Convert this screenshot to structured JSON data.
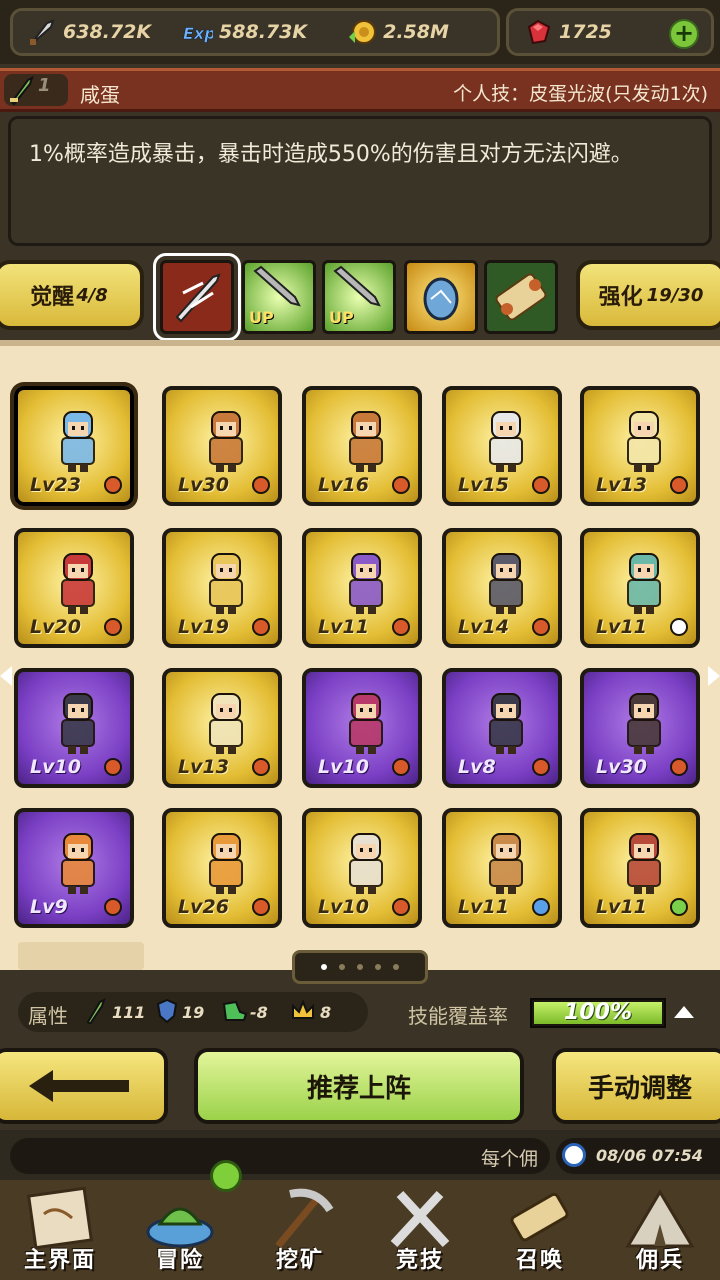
{
  "resources": {
    "attack": "638.72K",
    "exp": "588.73K",
    "gold": "2.58M",
    "gems": "1725"
  },
  "skill": {
    "level": "1",
    "name": "咸蛋",
    "personal": "个人技：皮蛋光波(只发动1次)",
    "description": "1%概率造成暴击，暴击时造成550%的伤害且对方无法闪避。"
  },
  "tabs": {
    "awaken_label": "觉醒",
    "awaken_count": "4/8",
    "enhance_label": "强化",
    "enhance_count": "19/30",
    "up1": "UP",
    "up2": "UP"
  },
  "heroes": [
    {
      "lv": "Lv23",
      "color": "gold"
    },
    {
      "lv": "Lv30",
      "color": "gold"
    },
    {
      "lv": "Lv16",
      "color": "gold"
    },
    {
      "lv": "Lv15",
      "color": "gold"
    },
    {
      "lv": "Lv13",
      "color": "gold"
    },
    {
      "lv": "Lv20",
      "color": "gold"
    },
    {
      "lv": "Lv19",
      "color": "gold"
    },
    {
      "lv": "Lv11",
      "color": "gold"
    },
    {
      "lv": "Lv14",
      "color": "gold"
    },
    {
      "lv": "Lv11",
      "color": "gold"
    },
    {
      "lv": "Lv10",
      "color": "purple"
    },
    {
      "lv": "Lv13",
      "color": "gold"
    },
    {
      "lv": "Lv10",
      "color": "purple"
    },
    {
      "lv": "Lv8",
      "color": "purple"
    },
    {
      "lv": "Lv30",
      "color": "purple"
    },
    {
      "lv": "Lv9",
      "color": "purple"
    },
    {
      "lv": "Lv26",
      "color": "gold"
    },
    {
      "lv": "Lv10",
      "color": "gold"
    },
    {
      "lv": "Lv11",
      "color": "gold"
    },
    {
      "lv": "Lv11",
      "color": "gold"
    }
  ],
  "attributes": {
    "label": "属性",
    "atk": "111",
    "def": "19",
    "spd": "-8",
    "crown": "8",
    "coverage_label": "技能覆盖率",
    "coverage_value": "100%",
    "coverage_fraction": 1.0
  },
  "buttons": {
    "recommend": "推荐上阵",
    "manual": "手动调整"
  },
  "bottom": {
    "message": "每个佣",
    "time": "08/06 07:54"
  },
  "nav": {
    "main": "主界面",
    "adventure": "冒险",
    "mine": "挖矿",
    "arena": "竞技",
    "summon": "召唤",
    "mercenary": "佣兵"
  },
  "colors": {
    "gold_card": "#e3bd34",
    "purple_card": "#7a3fc4",
    "skill_header": "#7a3220",
    "coverage_fill": "#9bd24a"
  }
}
